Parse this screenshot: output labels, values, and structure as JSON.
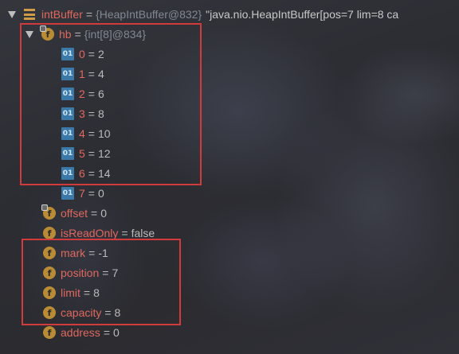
{
  "root": {
    "name": "intBuffer",
    "ref": "{HeapIntBuffer@832}",
    "summary": "\"java.nio.HeapIntBuffer[pos=7 lim=8 ca"
  },
  "hb": {
    "name": "hb",
    "ref": "{int[8]@834}",
    "items": [
      {
        "index": "0",
        "value": "2"
      },
      {
        "index": "1",
        "value": "4"
      },
      {
        "index": "2",
        "value": "6"
      },
      {
        "index": "3",
        "value": "8"
      },
      {
        "index": "4",
        "value": "10"
      },
      {
        "index": "5",
        "value": "12"
      },
      {
        "index": "6",
        "value": "14"
      },
      {
        "index": "7",
        "value": "0"
      }
    ],
    "icon_label": "01"
  },
  "fields": [
    {
      "name": "offset",
      "value": "0"
    },
    {
      "name": "isReadOnly",
      "value": "false"
    },
    {
      "name": "mark",
      "value": "-1"
    },
    {
      "name": "position",
      "value": "7"
    },
    {
      "name": "limit",
      "value": "8"
    },
    {
      "name": "capacity",
      "value": "8"
    },
    {
      "name": "address",
      "value": "0"
    }
  ],
  "equals": "=",
  "field_icon_label": "f",
  "colors": {
    "field_name": "#e0685e",
    "highlight_border": "#d13b3b",
    "field_icon": "#b98b35",
    "array_icon": "#3b79a8"
  }
}
